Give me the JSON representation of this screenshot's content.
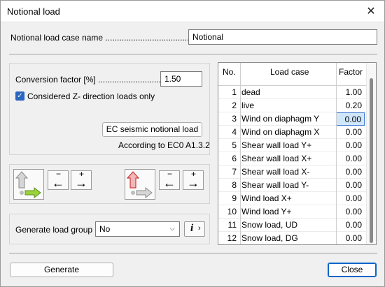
{
  "window": {
    "title": "Notional load",
    "close_glyph": "✕"
  },
  "case_name": {
    "label": "Notional load case name ....................................",
    "value": "Notional"
  },
  "conversion": {
    "label": "Conversion factor [%] ..............................",
    "value": "1.50"
  },
  "z_loads": {
    "label": "Considered Z- direction loads only",
    "checked": true,
    "check_glyph": "✓"
  },
  "ec_seismic": {
    "button_label": "EC seismic notional load",
    "note": "According to EC0 A1.3.2"
  },
  "icons": {
    "minus_left_sign": "−",
    "minus_right_sign": "+",
    "arrow_left": "←",
    "arrow_right": "→",
    "info_glyph": "i",
    "chevron": "›",
    "combo_arrow": "⌵"
  },
  "load_group": {
    "label": "Generate load group ...",
    "value": "No"
  },
  "table": {
    "headers": {
      "no": "No.",
      "name": "Load case",
      "factor": "Factor"
    },
    "rows": [
      {
        "no": "1",
        "name": "dead",
        "factor": "1.00"
      },
      {
        "no": "2",
        "name": "live",
        "factor": "0.20"
      },
      {
        "no": "3",
        "name": "Wind on diaphagm Y",
        "factor": "0.00"
      },
      {
        "no": "4",
        "name": "Wind on diaphagm X",
        "factor": "0.00"
      },
      {
        "no": "5",
        "name": "Shear wall load Y+",
        "factor": "0.00"
      },
      {
        "no": "6",
        "name": "Shear wall load X+",
        "factor": "0.00"
      },
      {
        "no": "7",
        "name": "Shear wall load X-",
        "factor": "0.00"
      },
      {
        "no": "8",
        "name": "Shear wall load Y-",
        "factor": "0.00"
      },
      {
        "no": "9",
        "name": "Wind load X+",
        "factor": "0.00"
      },
      {
        "no": "10",
        "name": "Wind load Y+",
        "factor": "0.00"
      },
      {
        "no": "11",
        "name": "Snow load, UD",
        "factor": "0.00"
      },
      {
        "no": "12",
        "name": "Snow load, DG",
        "factor": "0.00"
      }
    ],
    "selected_row": 2
  },
  "footer": {
    "generate_label": "Generate",
    "close_label": "Close"
  }
}
